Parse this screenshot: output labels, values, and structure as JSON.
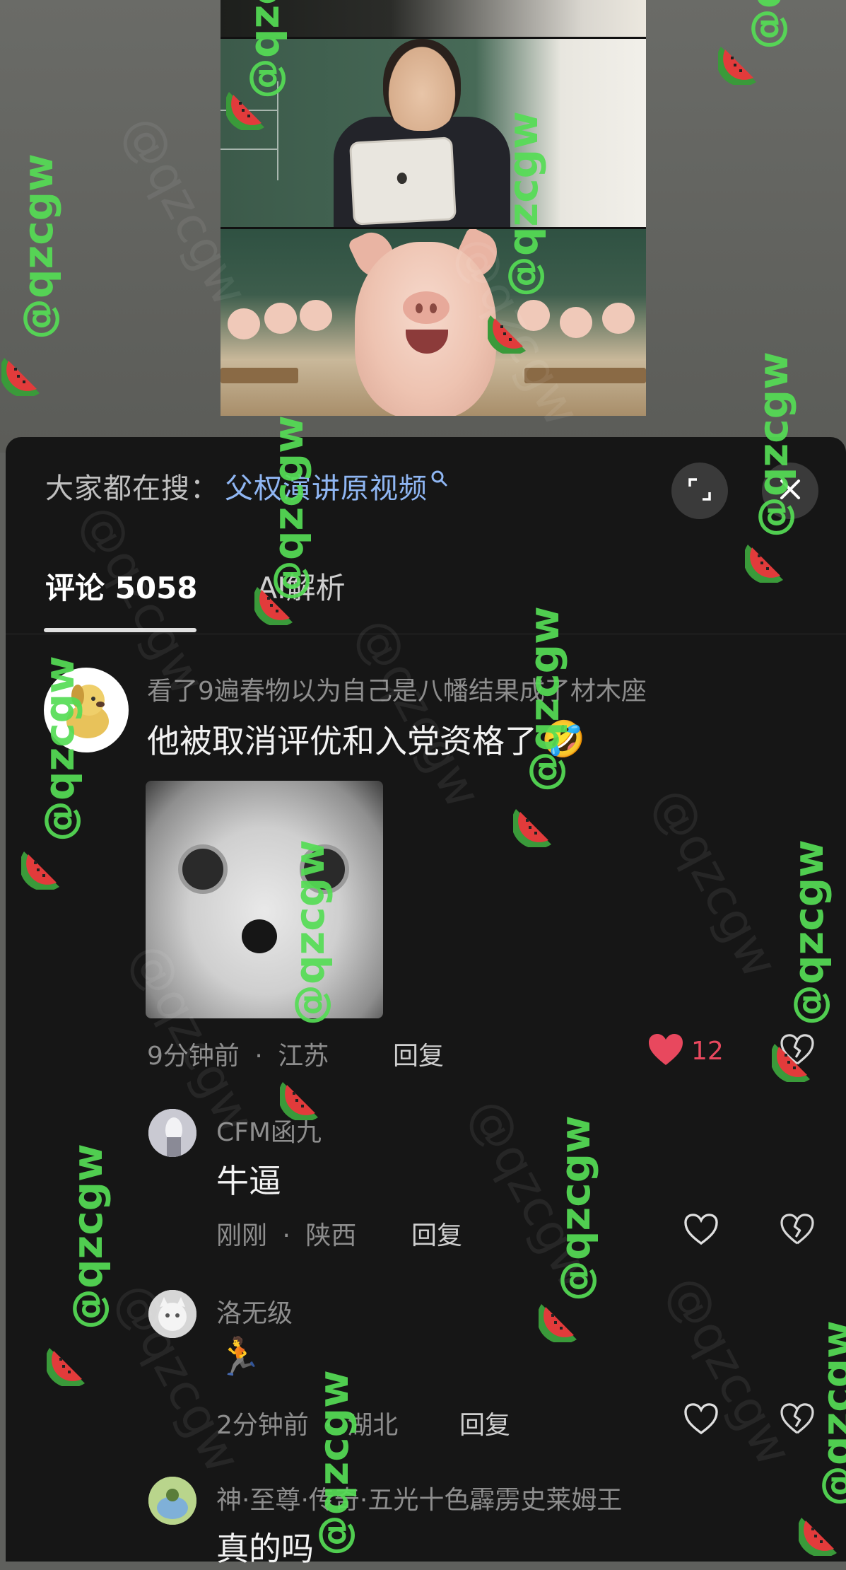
{
  "search": {
    "label": "大家都在搜：",
    "term": "父权演讲原视频"
  },
  "tabs": [
    {
      "label": "评论 5058",
      "active": true
    },
    {
      "label": "AI解析",
      "active": false
    }
  ],
  "comments": [
    {
      "user": "看了9遍春物以为自己是八幡结果成了材木座",
      "text": "他被取消评优和入党资格了",
      "emoji": "🤣",
      "time": "9分钟前",
      "location": "江苏",
      "reply_label": "回复",
      "likes": "12",
      "liked": true
    },
    {
      "user": "CFM函九",
      "text": "牛逼",
      "time": "刚刚",
      "location": "陕西",
      "reply_label": "回复"
    },
    {
      "user": "洛无级",
      "text": "",
      "emoji": "🏃",
      "time": "2分钟前",
      "location": "湖北",
      "reply_label": "回复"
    },
    {
      "user": "神·至尊·传奇·五光十色霹雳史莱姆王",
      "text": "真的吗"
    }
  ],
  "meta_separator": "·",
  "watermark": "@qzcgw",
  "colors": {
    "panel_bg": "#161616",
    "search_term": "#8fb6f3",
    "like_red": "#e8485e",
    "watermark_green": "#55dd55"
  },
  "icons": [
    "search-icon",
    "expand-icon",
    "close-icon",
    "heart-icon",
    "broken-heart-icon",
    "watermelon-icon"
  ]
}
